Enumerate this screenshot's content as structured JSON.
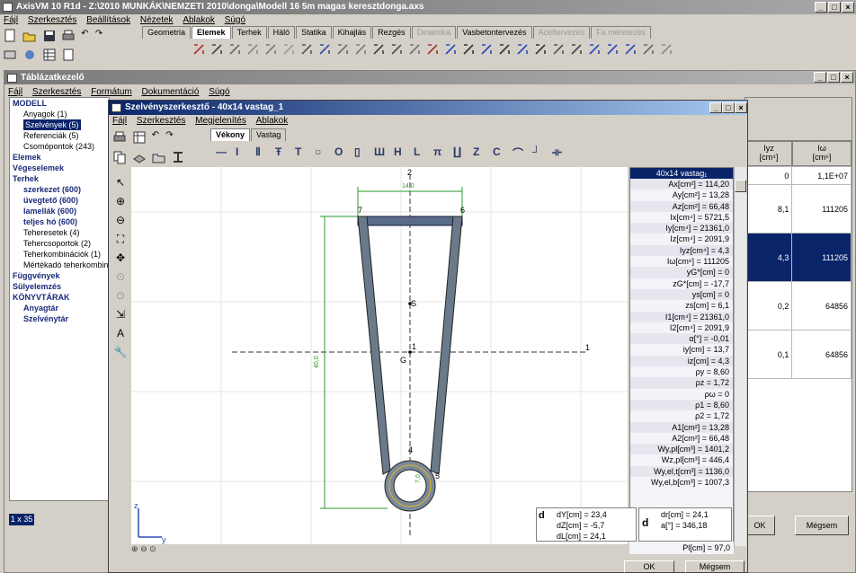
{
  "main_window": {
    "title": "AxisVM 10 R1d - Z:\\2010 MUNKÁK\\NEMZETI 2010\\donga\\Modell 16 5m magas keresztdonga.axs"
  },
  "main_menu": [
    "Fájl",
    "Szerkesztés",
    "Beállítások",
    "Nézetek",
    "Ablakok",
    "Súgó"
  ],
  "main_tabs": [
    {
      "label": "Geometria",
      "state": "normal"
    },
    {
      "label": "Elemek",
      "state": "selected"
    },
    {
      "label": "Terhek",
      "state": "normal"
    },
    {
      "label": "Háló",
      "state": "normal"
    },
    {
      "label": "Statika",
      "state": "normal"
    },
    {
      "label": "Kihajlás",
      "state": "normal"
    },
    {
      "label": "Rezgés",
      "state": "normal"
    },
    {
      "label": "Dinamika",
      "state": "disabled"
    },
    {
      "label": "Vasbetontervezés",
      "state": "normal"
    },
    {
      "label": "Acéltervezés",
      "state": "disabled"
    },
    {
      "label": "Fa méretezés",
      "state": "disabled"
    }
  ],
  "table_window": {
    "title": "Táblázatkezelő",
    "menu": [
      "Fájl",
      "Szerkesztés",
      "Formátum",
      "Dokumentáció",
      "Súgó"
    ],
    "status": "1 x 35"
  },
  "tree": [
    {
      "label": "MODELL",
      "style": "bold"
    },
    {
      "label": "Anyagok (1)",
      "style": "normal"
    },
    {
      "label": "Szelvények (5)",
      "style": "selected"
    },
    {
      "label": "Referenciák (5)",
      "style": "normal"
    },
    {
      "label": "Csomópontok (243)",
      "style": "normal"
    },
    {
      "label": "Elemek",
      "style": "bold"
    },
    {
      "label": "Végeselemek",
      "style": "bold"
    },
    {
      "label": "Terhek",
      "style": "bold"
    },
    {
      "label": "szerkezet (600)",
      "style": "bold"
    },
    {
      "label": "üvegtető (600)",
      "style": "bold"
    },
    {
      "label": "lamellák (600)",
      "style": "bold"
    },
    {
      "label": "teljes hó (600)",
      "style": "bold"
    },
    {
      "label": "Teheresetek (4)",
      "style": "normal"
    },
    {
      "label": "Tehercsoportok (2)",
      "style": "normal"
    },
    {
      "label": "Teherkombinációk (1)",
      "style": "normal"
    },
    {
      "label": "Mértékadó teherkombin",
      "style": "normal"
    },
    {
      "label": "Függvények",
      "style": "bold"
    },
    {
      "label": "Sülyelemzés",
      "style": "bold"
    },
    {
      "label": "KÖNYVTÁRAK",
      "style": "bold"
    },
    {
      "label": "Anyagtár",
      "style": "bold"
    },
    {
      "label": "Szelvénytár",
      "style": "bold"
    }
  ],
  "bg_table": {
    "headers": [
      "Iyz\n[cm⁴]",
      "Iω\n[cm⁶]"
    ],
    "rows": [
      [
        "0",
        "1,1E+07"
      ],
      [
        "8,1",
        "111205"
      ],
      [
        "4,3",
        "111205"
      ],
      [
        "0,2",
        "64856"
      ],
      [
        "0,1",
        "64856"
      ]
    ],
    "selected_row": 2
  },
  "bg_buttons": {
    "ok": "OK",
    "cancel": "Mégsem"
  },
  "editor": {
    "title": "Szelvényszerkesztő - 40x14 vastag_1",
    "menu": [
      "Fájl",
      "Szerkesztés",
      "Megjelenítés",
      "Ablakok"
    ],
    "tabs": [
      "Vékony",
      "Vastag"
    ],
    "section_name": "40x14 vastag₁",
    "ok": "OK",
    "cancel": "Mégsem"
  },
  "properties": [
    "Ax[cm²] = 114,20",
    "Ay[cm²] = 13,28",
    "Az[cm²] = 66,48",
    "Ix[cm⁴] = 5721,5",
    "Iy[cm⁴] = 21361,0",
    "Iz[cm⁴] = 2091,9",
    "Iyz[cm⁴] = 4,3",
    "Iω[cm⁶] = 111205",
    "yG*[cm] = 0",
    "zG*[cm] = -17,7",
    "ys[cm] = 0",
    "zs[cm] = 6,1",
    "I1[cm⁴] = 21361,0",
    "I2[cm⁴] = 2091,9",
    "α[°] = -0,01",
    "iy[cm] = 13,7",
    "iz[cm] = 4,3",
    "ρy = 8,60",
    "ρz = 1,72",
    "ρω = 0",
    "ρ1 = 8,60",
    "ρ2 = 1,72",
    "A1[cm²] = 13,28",
    "A2[cm²] = 66,48",
    "Wy,pl[cm³] = 1401,2",
    "Wz,pl[cm³] = 446,4",
    "Wy,el,t[cm³] = 1136,0",
    "Wy,el,b[cm³] = 1007,3"
  ],
  "last_prop": "Pl[cm] = 97,0",
  "coords": {
    "dy": "dY[cm] = 23,4",
    "dz": "dZ[cm] = -5,7",
    "dl": "dL[cm] = 24,1",
    "dr": "dr[cm] = 24,1",
    "da": "a[°] = 346,18"
  },
  "drawing": {
    "labels": {
      "axis2": "2",
      "axis1": "1",
      "n7": "7",
      "n6": "6",
      "n4": "4",
      "n5": "5",
      "s": "S",
      "g": "G",
      "one_a": "1",
      "dim_top": "14,0",
      "dim_side": "40,0",
      "dim_ring": "7,0",
      "axis_z": "z",
      "axis_y": "y"
    }
  }
}
